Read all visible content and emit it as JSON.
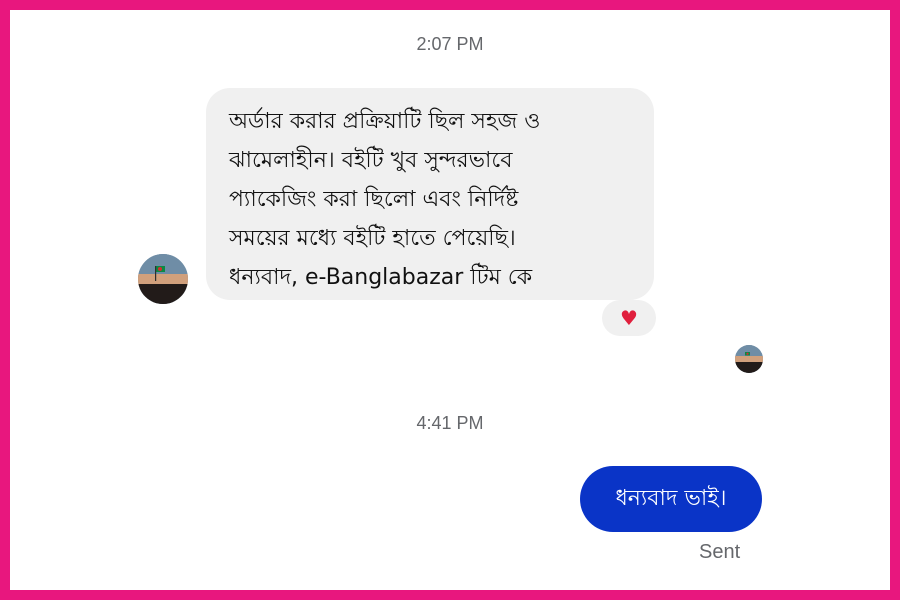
{
  "conversation": {
    "timestamps": [
      "2:07 PM",
      "4:41 PM"
    ],
    "incoming_message": {
      "lines": [
        "অর্ডার করার প্রক্রিয়াটি ছিল সহজ ও",
        "ঝামেলাহীন। বইটি খুব সুন্দরভাবে",
        "প্যাকেজিং করা ছিলো এবং নির্দিষ্ট",
        "সময়ের মধ্যে বইটি হাতে পেয়েছি।",
        "ধন্যবাদ, e-Banglabazar টিম কে"
      ],
      "reaction": "♥",
      "reaction_color": "#e01f3d"
    },
    "outgoing_message": {
      "text": "ধন্যবাদ ভাই।",
      "status": "Sent",
      "bubble_color": "#0a34c7"
    }
  },
  "theme": {
    "frame_color": "#e8177e",
    "incoming_bubble_color": "#f0f0f0",
    "timestamp_color": "#65676b"
  },
  "icons": {
    "reaction_icon": "heart-icon",
    "contact_avatar_icon": "sunset-flag-avatar-icon",
    "read_receipt_icon": "avatar-read-receipt-icon"
  }
}
